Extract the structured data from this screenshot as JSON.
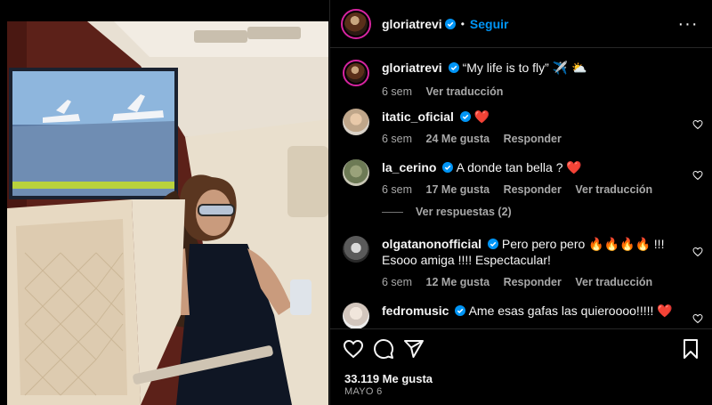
{
  "header": {
    "username": "gloriatrevi",
    "separator": "•",
    "follow_label": "Seguir",
    "more_label": "···"
  },
  "caption": {
    "username": "gloriatrevi",
    "text": "“My life is to fly” ✈️ ⛅",
    "time": "6 sem",
    "translate": "Ver traducción"
  },
  "comments": [
    {
      "username": "itatic_oficial",
      "text": "❤️",
      "time": "6 sem",
      "likes": "24 Me gusta",
      "reply": "Responder",
      "translate": ""
    },
    {
      "username": "la_cerino",
      "text": "A donde tan bella ? ❤️",
      "time": "6 sem",
      "likes": "17 Me gusta",
      "reply": "Responder",
      "translate": "Ver traducción"
    },
    {
      "username": "olgatanonofficial",
      "text": "Pero pero pero 🔥🔥🔥🔥 !!! Esooo amiga !!!! Espectacular!",
      "time": "6 sem",
      "likes": "12 Me gusta",
      "reply": "Responder",
      "translate": "Ver traducción"
    },
    {
      "username": "fedromusic",
      "text": "Ame esas gafas las quieroooo!!!!! ❤️",
      "time": "",
      "likes": "",
      "reply": "",
      "translate": ""
    }
  ],
  "view_replies": "Ver respuestas (2)",
  "footer": {
    "likes": "33.119 Me gusta",
    "date": "MAYO 6"
  },
  "icons": {
    "like": "heart-icon",
    "comment": "comment-icon",
    "share": "share-icon",
    "save": "bookmark-icon",
    "verified": "verified-badge-icon"
  },
  "colors": {
    "background": "#000000",
    "accent": "#0095f6",
    "muted": "#a8a8a8",
    "verified": "#0095f6",
    "heart": "#ff3040"
  }
}
